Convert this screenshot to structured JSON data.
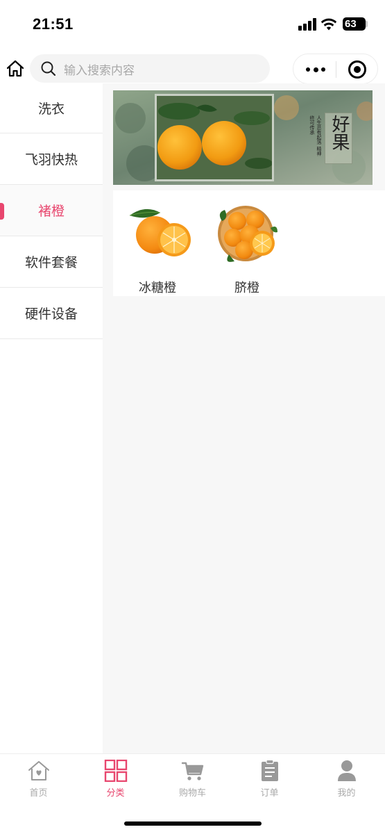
{
  "status_bar": {
    "time": "21:51",
    "battery": "63"
  },
  "search": {
    "placeholder": "输入搜索内容"
  },
  "sidebar": {
    "items": [
      {
        "label": "洗衣"
      },
      {
        "label": "飞羽快热"
      },
      {
        "label": "褚橙",
        "active": true
      },
      {
        "label": "软件套餐"
      },
      {
        "label": "硬件设备"
      }
    ]
  },
  "banner": {
    "title": "好果",
    "poem": "人生总有起落 精神终可传承"
  },
  "products": [
    {
      "name": "冰糖橙"
    },
    {
      "name": "脐橙"
    }
  ],
  "tabbar": {
    "items": [
      {
        "label": "首页",
        "icon": "home-icon"
      },
      {
        "label": "分类",
        "icon": "grid-icon",
        "active": true
      },
      {
        "label": "购物车",
        "icon": "cart-icon"
      },
      {
        "label": "订单",
        "icon": "clipboard-icon"
      },
      {
        "label": "我的",
        "icon": "user-icon"
      }
    ]
  },
  "colors": {
    "accent": "#e8466e",
    "inactive": "#aaaaaa",
    "content_bg": "#f7f7f7"
  }
}
